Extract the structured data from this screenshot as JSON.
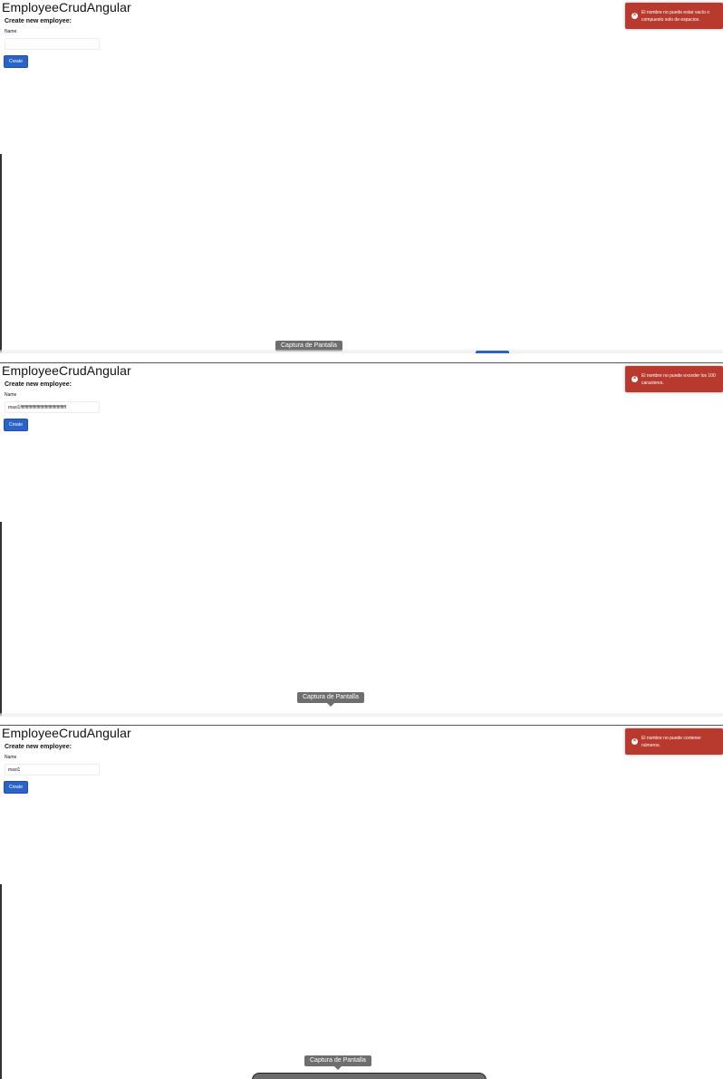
{
  "screens": [
    {
      "app_title": "EmployeeCrudAngular",
      "form_title": "Create new employee:",
      "name_label": "Name",
      "name_value": "",
      "create_label": "Create",
      "toast_message": "El nombre no puede estar vacío o compuesto solo de espacios.",
      "tooltip": "Captura de Pantalla"
    },
    {
      "app_title": "EmployeeCrudAngular",
      "form_title": "Create new employee:",
      "name_label": "Name",
      "name_value": "maxi1fffffffffffffffffffffffffffffffffffffff",
      "create_label": "Create",
      "toast_message": "El nombre no puede exceder los 100 caracteres.",
      "tooltip": "Captura de Pantalla"
    },
    {
      "app_title": "EmployeeCrudAngular",
      "form_title": "Create new employee:",
      "name_label": "Name",
      "name_value": "maxi1",
      "create_label": "Create",
      "toast_message": "El nombre no puede contener números.",
      "tooltip": "Captura de Pantalla"
    }
  ],
  "colors": {
    "toast_error": "#b83a2e",
    "primary_button": "#2a64c9",
    "tooltip_bg": "#6e6e6e"
  },
  "icons": {
    "toast": "error-circle-x-icon"
  }
}
